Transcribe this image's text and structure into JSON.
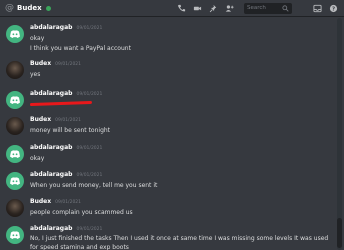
{
  "header": {
    "channel_title": "Budex",
    "search_placeholder": "Search"
  },
  "colors": {
    "background": "#36393f",
    "online": "#3ba55c",
    "bot_avatar": "#43b581",
    "redaction": "#e8181b"
  },
  "messages": [
    {
      "author": "abdalaragab",
      "time": "09/01/2021",
      "text": "okay"
    },
    {
      "text": "I think you want a PayPal account"
    },
    {
      "author": "Budex",
      "time": "09/01/2021",
      "text": "yes"
    },
    {
      "author": "abdalaragab",
      "time": "09/01/2021",
      "text": ""
    },
    {
      "author": "Budex",
      "time": "09/01/2021",
      "text": "money will be sent tonight"
    },
    {
      "author": "abdalaragab",
      "time": "09/01/2021",
      "text": "okay"
    },
    {
      "author": "abdalaragab",
      "time": "09/01/2021",
      "text": "When you send money, tell me you sent it"
    },
    {
      "author": "Budex",
      "time": "09/01/2021",
      "text": "people complain you scammed us"
    },
    {
      "author": "abdalaragab",
      "time": "09/01/2021",
      "text": "No, I just finished the tasks  Then I used it once at same time I was missing some levels  It was used for speed stamina and exp boots"
    }
  ]
}
